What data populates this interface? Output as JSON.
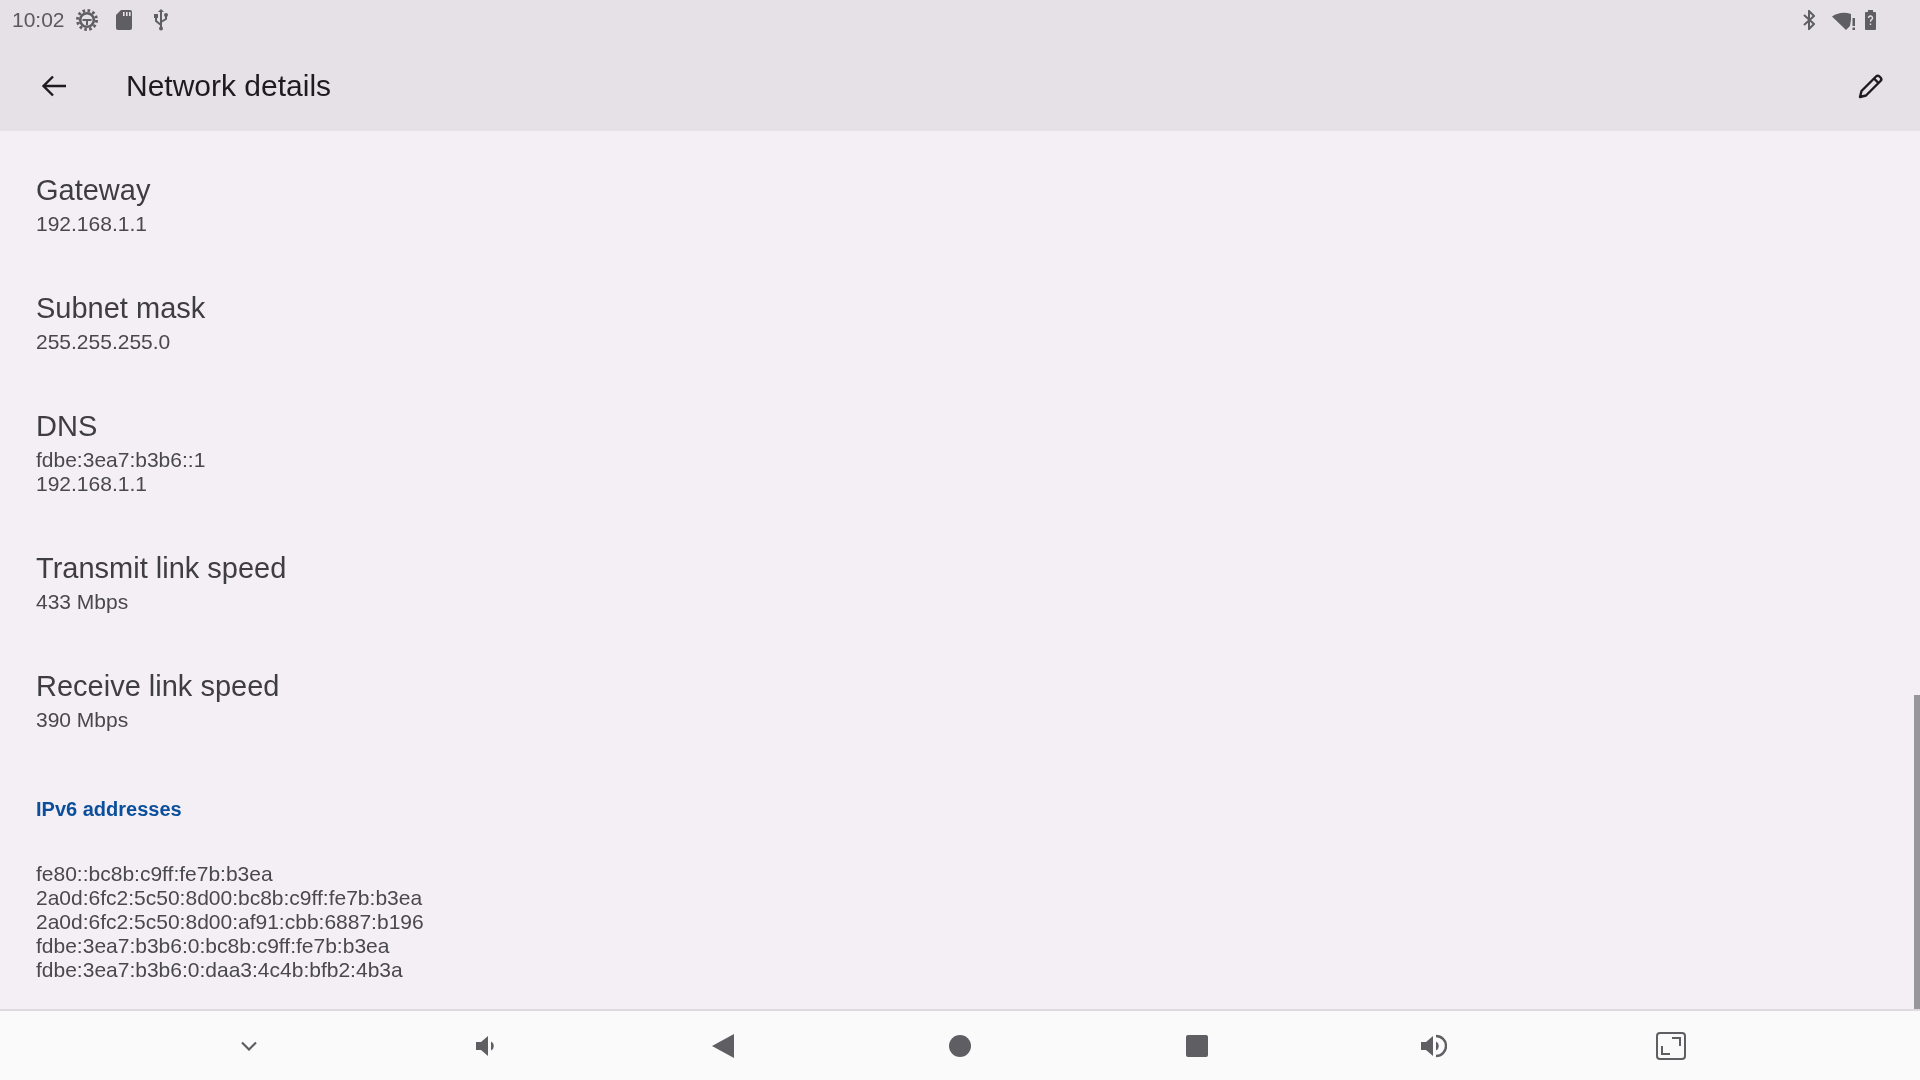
{
  "status_bar": {
    "time": "10:02"
  },
  "app_bar": {
    "title": "Network details"
  },
  "details": [
    {
      "title": "Gateway",
      "values": [
        "192.168.1.1"
      ]
    },
    {
      "title": "Subnet mask",
      "values": [
        "255.255.255.0"
      ]
    },
    {
      "title": "DNS",
      "values": [
        "fdbe:3ea7:b3b6::1",
        "192.168.1.1"
      ]
    },
    {
      "title": "Transmit link speed",
      "values": [
        "433 Mbps"
      ]
    },
    {
      "title": "Receive link speed",
      "values": [
        "390 Mbps"
      ]
    }
  ],
  "ipv6_section": {
    "heading": "IPv6 addresses",
    "addresses": [
      "fe80::bc8b:c9ff:fe7b:b3ea",
      "2a0d:6fc2:5c50:8d00:bc8b:c9ff:fe7b:b3ea",
      "2a0d:6fc2:5c50:8d00:af91:cbb:6887:b196",
      "fdbe:3ea7:b3b6:0:bc8b:c9ff:fe7b:b3ea",
      "fdbe:3ea7:b3b6:0:daa3:4c4b:bfb2:4b3a"
    ]
  }
}
